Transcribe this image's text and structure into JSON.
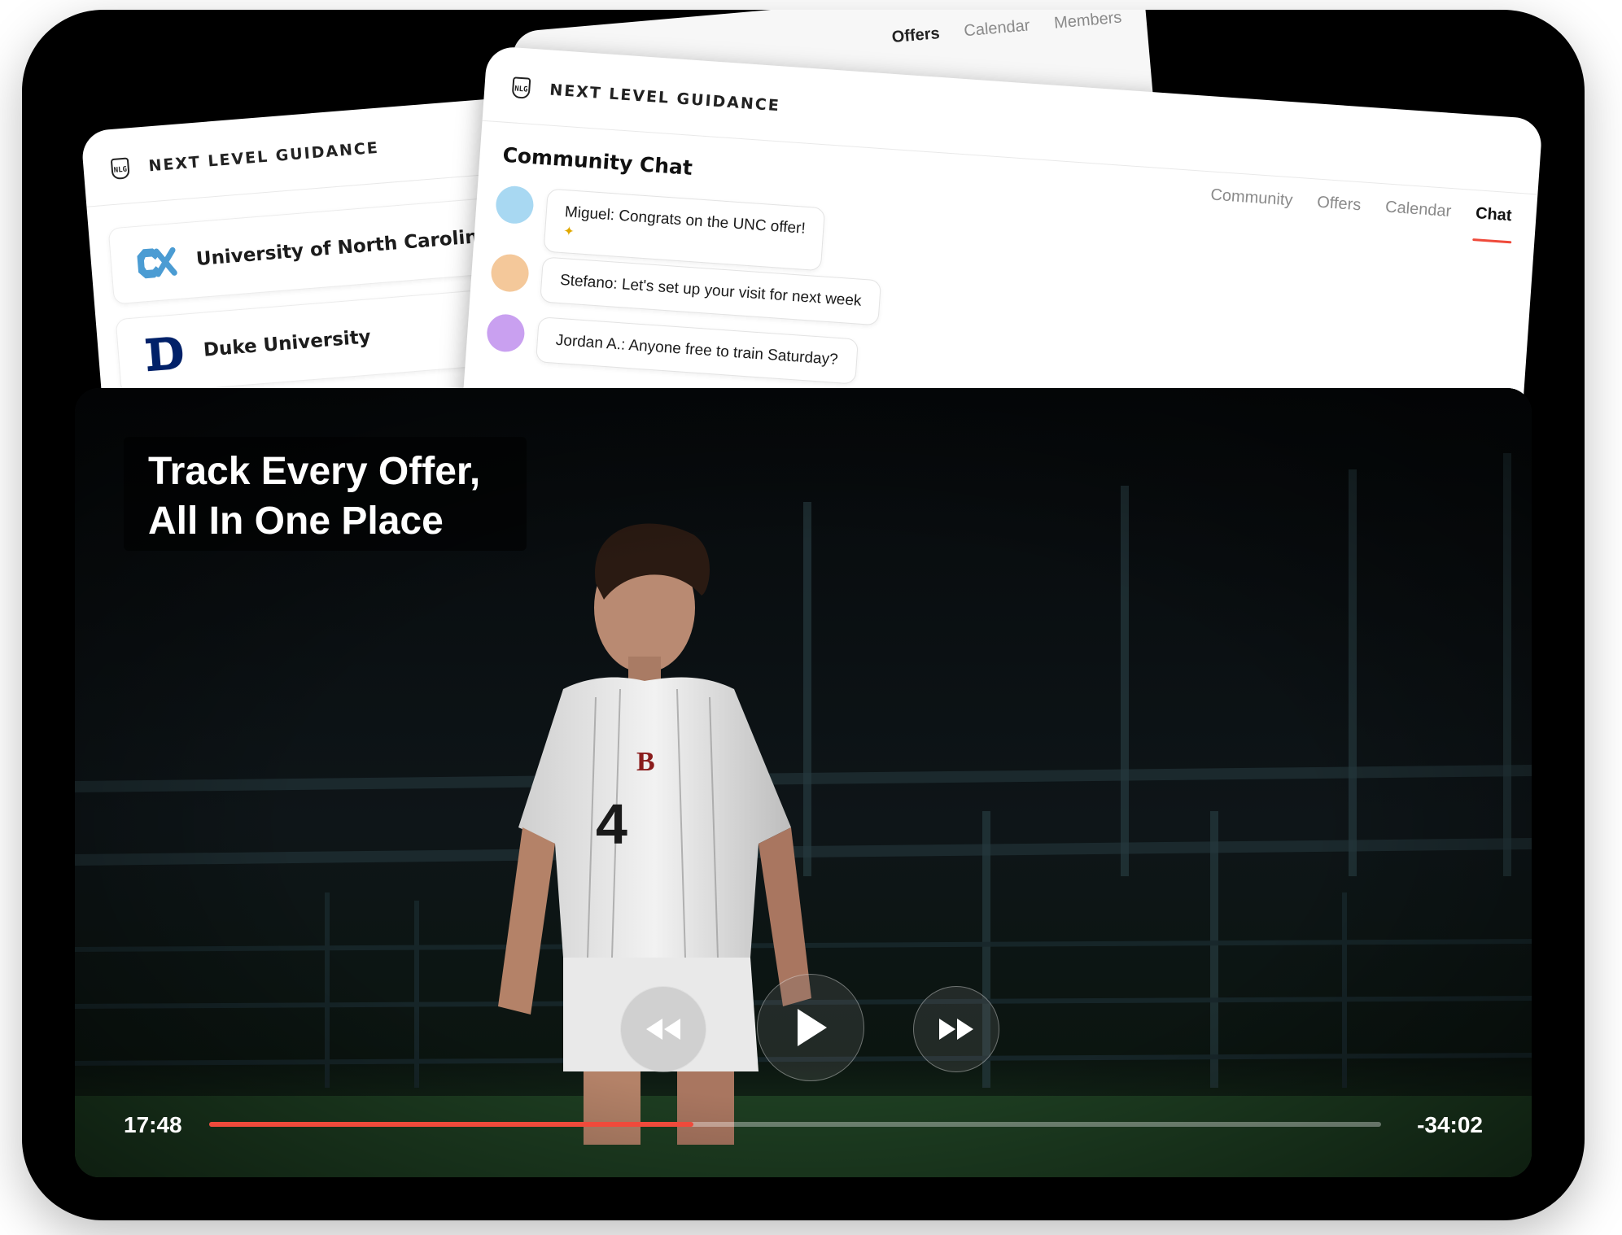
{
  "brand": "NEXT LEVEL GUIDANCE",
  "logo_text": "NLG",
  "back_card": {
    "nav": [
      "Offers",
      "Calendar",
      "Members"
    ]
  },
  "offers_card": {
    "universities": [
      {
        "name": "University of North Carolina",
        "logo": "unc-logo",
        "color": "#4b9cd3"
      },
      {
        "name": "Duke University",
        "logo": "duke-logo",
        "color": "#012169"
      }
    ]
  },
  "chat_card": {
    "nav": [
      "Community",
      "Offers",
      "Calendar",
      "Chat"
    ],
    "active_tab": "Chat",
    "title": "Community Chat",
    "messages": [
      {
        "text": "Miguel: Congrats on the UNC offer!",
        "emoji": "party-popper",
        "avatar_color": "#a8d8f2"
      },
      {
        "text": "Stefano: Let's set up your visit for next week",
        "avatar_color": "#f4c89a"
      },
      {
        "text": "Jordan A.: Anyone free to train Saturday?",
        "avatar_color": "#c9a0f0"
      }
    ]
  },
  "player": {
    "headline_line1": "Track Every Offer,",
    "headline_line2": "All In One Place",
    "elapsed": "17:48",
    "remaining": "-34:02",
    "progress": 0.413,
    "jersey_number": "4",
    "jersey_letter": "B",
    "controls": [
      "rewind-icon",
      "play-icon",
      "fast-forward-icon"
    ]
  },
  "accent_color": "#ef4a3b"
}
